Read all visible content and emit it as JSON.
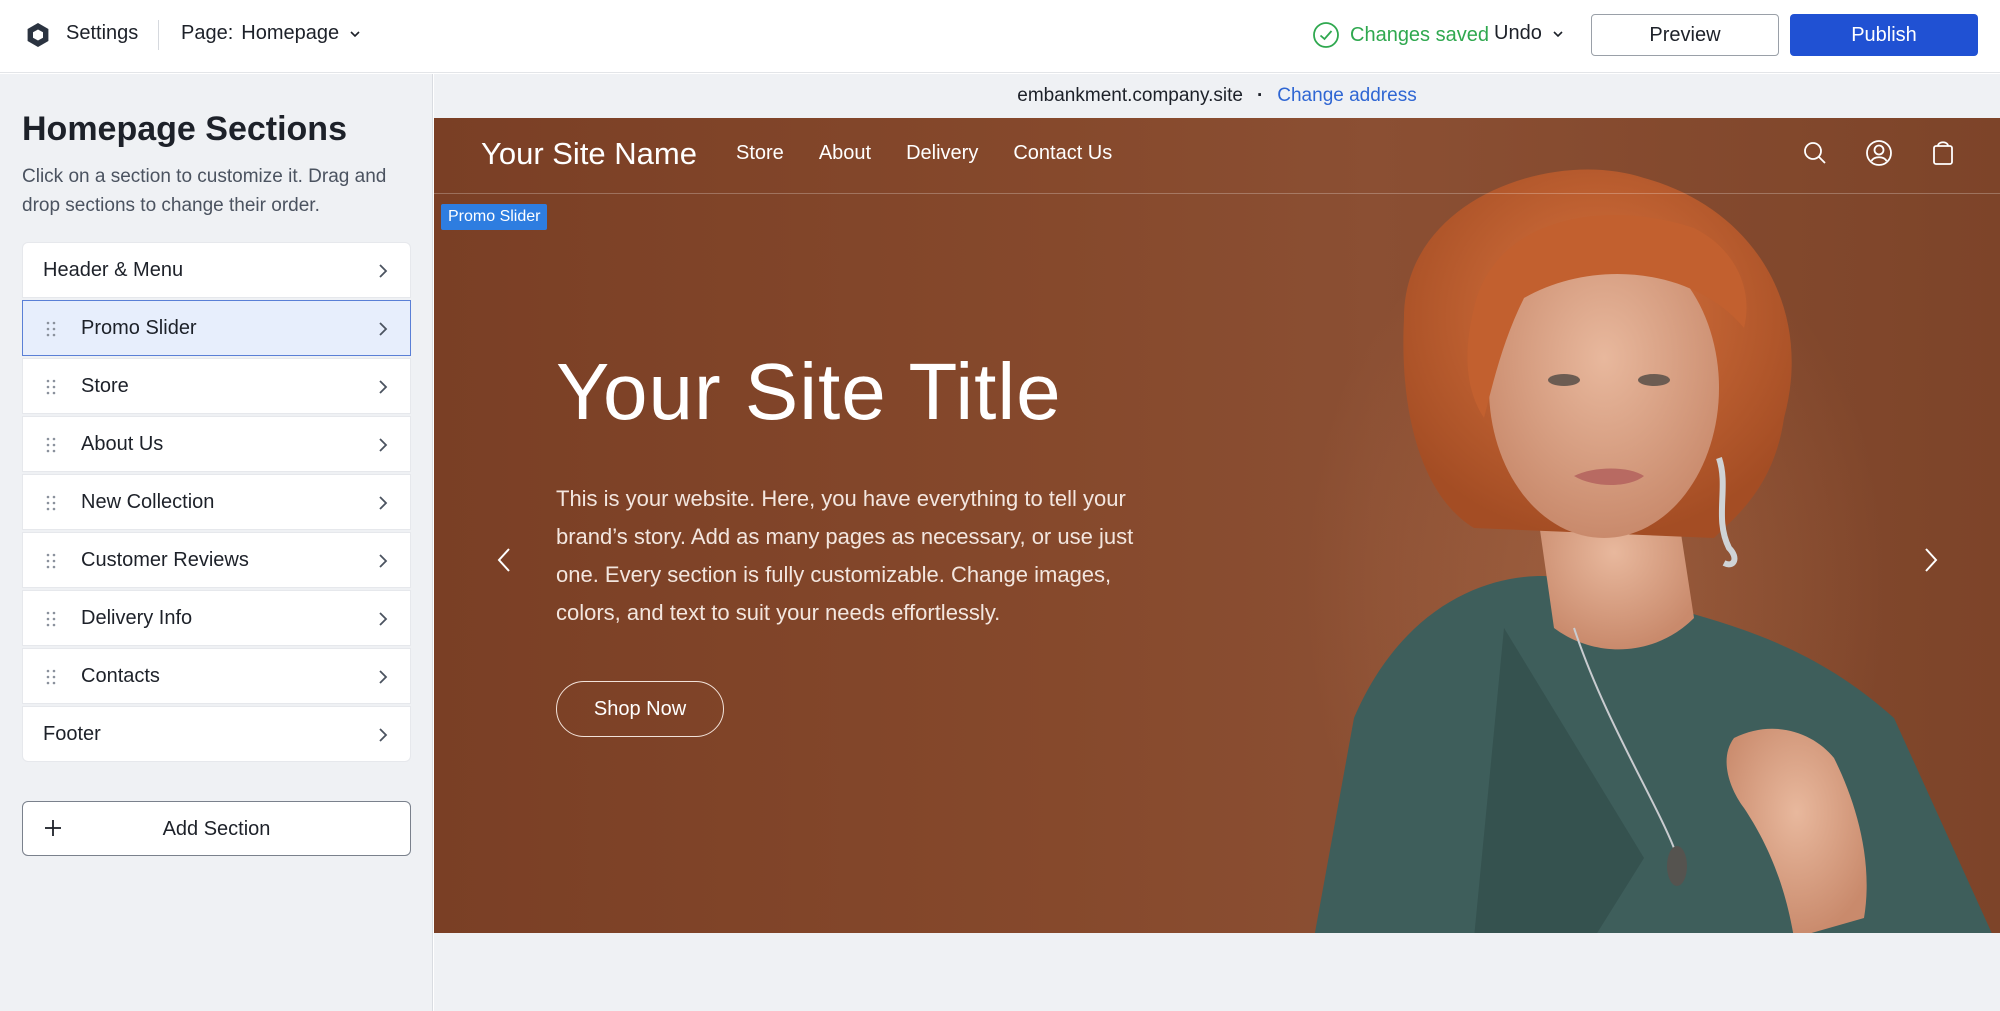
{
  "topbar": {
    "logo_icon": "hexagon-logo-icon",
    "settings_label": "Settings",
    "page_prefix": "Page:",
    "page_value": "Homepage",
    "saved_label": "Changes saved",
    "undo_label": "Undo",
    "preview_label": "Preview",
    "publish_label": "Publish"
  },
  "colors": {
    "accent": "#2051d3",
    "success": "#2fa84f",
    "link": "#2f66d3",
    "promo_tag": "#2e7de0"
  },
  "sidebar": {
    "title": "Homepage Sections",
    "description": "Click on a section to customize it. Drag and drop sections to change their order.",
    "items": [
      {
        "label": "Header & Menu",
        "draggable": false,
        "selected": false
      },
      {
        "label": "Promo Slider",
        "draggable": true,
        "selected": true
      },
      {
        "label": "Store",
        "draggable": true,
        "selected": false
      },
      {
        "label": "About Us",
        "draggable": true,
        "selected": false
      },
      {
        "label": "New Collection",
        "draggable": true,
        "selected": false
      },
      {
        "label": "Customer Reviews",
        "draggable": true,
        "selected": false
      },
      {
        "label": "Delivery Info",
        "draggable": true,
        "selected": false
      },
      {
        "label": "Contacts",
        "draggable": true,
        "selected": false
      },
      {
        "label": "Footer",
        "draggable": false,
        "selected": false
      }
    ],
    "add_section_label": "Add Section"
  },
  "canvas": {
    "address": "embankment.company.site",
    "address_separator": "·",
    "change_address_label": "Change address"
  },
  "site": {
    "name": "Your Site Name",
    "menu": [
      "Store",
      "About",
      "Delivery",
      "Contact Us"
    ],
    "icons": [
      "search-icon",
      "account-icon",
      "cart-bag-icon"
    ],
    "promo_tag": "Promo Slider",
    "hero_title": "Your Site Title",
    "hero_text": "This is your website. Here, you have everything to tell your brand’s story. Add as many pages as necessary, or use just one. Every section is fully customizable. Change images, colors, and text to suit your needs effortlessly.",
    "cta_label": "Shop Now",
    "slides_total": 3,
    "active_slide": 1
  }
}
